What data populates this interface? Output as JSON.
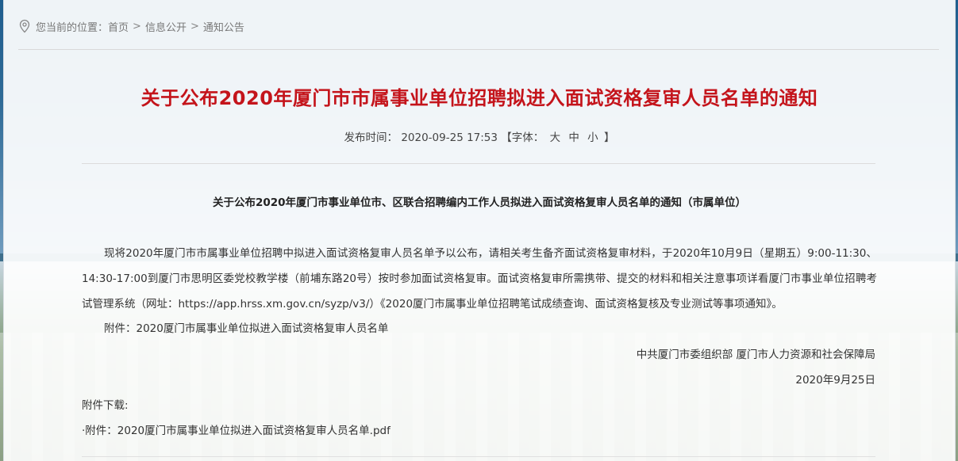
{
  "breadcrumb": {
    "prefix": "您当前的位置：",
    "items": [
      "首页",
      "信息公开",
      "通知公告"
    ],
    "separator": ">"
  },
  "article": {
    "title": "关于公布2020年厦门市市属事业单位招聘拟进入面试资格复审人员名单的通知",
    "meta": {
      "published_label": "发布时间：",
      "published_value": "2020-09-25 17:53",
      "font_open": "【字体：",
      "font_sizes": [
        "大",
        "中",
        "小"
      ],
      "font_close": "】"
    },
    "subtitle": "关于公布2020年厦门市事业单位市、区联合招聘编内工作人员拟进入面试资格复审人员名单的通知（市属单位）",
    "paragraph": "现将2020年厦门市市属事业单位招聘中拟进入面试资格复审人员名单予以公布，请相关考生备齐面试资格复审材料，于2020年10月9日（星期五）9:00-11:30、14:30-17:00到厦门市思明区委党校教学楼（前埔东路20号）按时参加面试资格复审。面试资格复审所需携带、提交的材料和相关注意事项详看厦门市事业单位招聘考试管理系统（网址：https://app.hrss.xm.gov.cn/syzp/v3/）《2020厦门市属事业单位招聘笔试成绩查询、面试资格复核及专业测试等事项通知》。",
    "attachment_note": "附件：2020厦门市属事业单位拟进入面试资格复审人员名单",
    "signature": "中共厦门市委组织部  厦门市人力资源和社会保障局",
    "date": "2020年9月25日"
  },
  "downloads": {
    "label": "附件下载:",
    "items": [
      "·附件：2020厦门市属事业单位拟进入面试资格复审人员名单.pdf"
    ]
  },
  "colors": {
    "title": "#c4141b",
    "text": "#333333",
    "muted": "#777777"
  },
  "icons": [
    "location-pin-icon"
  ]
}
